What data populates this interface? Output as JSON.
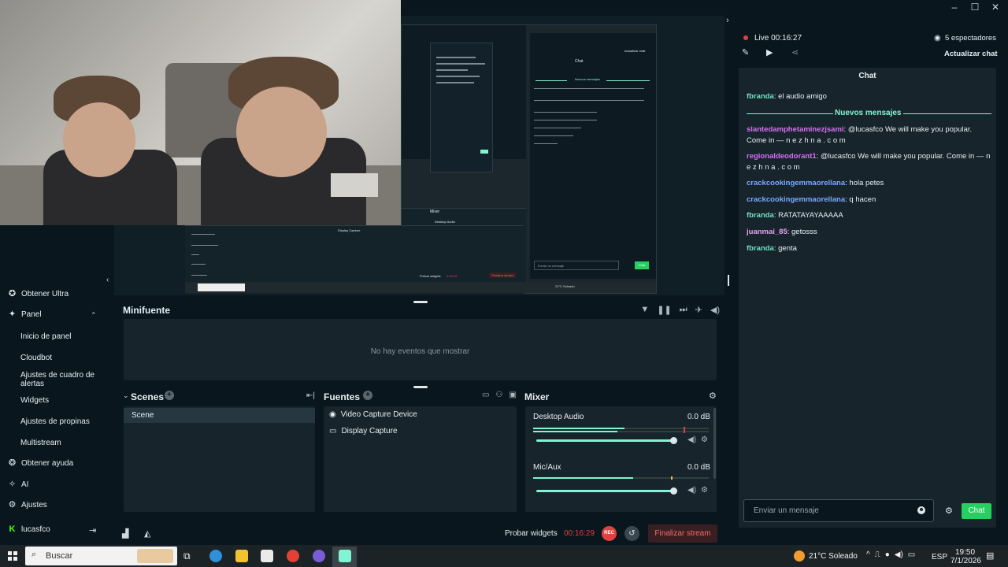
{
  "window": {
    "minimize": "–",
    "maximize": "☐",
    "close": "✕"
  },
  "preview": {
    "nested_chat_title": "Chat",
    "nested_new_messages": "Nuevos mensajes",
    "nested_update": "Actualizar chat",
    "nested_finalize": "Finalizar stream",
    "nested_probar": "Probar widgets",
    "nested_mixer": "Mixer",
    "nested_desktop_audio": "Desktop Audio",
    "nested_mic": "Mic/Aux",
    "nested_display": "Display Capture",
    "nested_input": "Enviar un mensaje",
    "nested_send": "Chat",
    "nested_time": "0:16:29",
    "nested_weather": "21°C Soleado"
  },
  "sidebar": {
    "items": [
      {
        "label": "Obtener Ultra",
        "icon": "ultra-icon"
      },
      {
        "label": "Panel",
        "icon": "dashboard-icon"
      },
      {
        "label": "Inicio de panel"
      },
      {
        "label": "Cloudbot"
      },
      {
        "label": "Ajustes de cuadro de alertas"
      },
      {
        "label": "Widgets"
      },
      {
        "label": "Ajustes de propinas"
      },
      {
        "label": "Multistream"
      },
      {
        "label": "Obtener ayuda",
        "icon": "help-icon"
      },
      {
        "label": "AI",
        "icon": "ai-icon"
      },
      {
        "label": "Ajustes",
        "icon": "gear-icon"
      },
      {
        "label": "lucasfco",
        "icon": "kick-icon"
      }
    ]
  },
  "minifuente": {
    "title": "Minifuente",
    "empty": "No hay eventos que mostrar"
  },
  "scenes": {
    "title": "Scenes",
    "items": [
      "Scene"
    ]
  },
  "sources": {
    "title": "Fuentes",
    "items": [
      "Video Capture Device",
      "Display Capture"
    ]
  },
  "mixer": {
    "title": "Mixer",
    "channels": [
      {
        "name": "Desktop Audio",
        "db": "0.0 dB",
        "level": 0.52,
        "volume": 1.0
      },
      {
        "name": "Mic/Aux",
        "db": "0.0 dB",
        "level": 0.57,
        "volume": 1.0
      }
    ]
  },
  "footer": {
    "probar": "Probar widgets",
    "time": "00:16:29",
    "rec": "REC",
    "end": "Finalizar stream"
  },
  "chat": {
    "live": "Live 00:16:27",
    "viewers": "5 espectadores",
    "update": "Actualizar chat",
    "title": "Chat",
    "new_messages": "Nuevos mensajes",
    "messages": [
      {
        "user": "fbranda",
        "text": ": el audio amigo",
        "color": "#6ee2c2"
      },
      {
        "user": "slantedamphetaminezjsami",
        "text": ": @lucasfco We will make you popular. Come in — n e z h n a . c o m",
        "color": "#d76ff3"
      },
      {
        "user": "regionaldeodorant1",
        "text": ": @lucasfco We will make you popular. Come in — n e z h n a . c o m",
        "color": "#d76ff3"
      },
      {
        "user": "crackcookingemmaorellana",
        "text": ": hola petes",
        "color": "#7aa9ff"
      },
      {
        "user": "crackcookingemmaorellana",
        "text": ": q hacen",
        "color": "#7aa9ff"
      },
      {
        "user": "fbranda",
        "text": ": RATATAYAYAAAAA",
        "color": "#6ee2c2"
      },
      {
        "user": "juanmai_85",
        "text": ": getosss",
        "color": "#e5a3f2"
      },
      {
        "user": "fbranda",
        "text": ": genta",
        "color": "#6ee2c2"
      }
    ],
    "input_placeholder": "Enviar un mensaje",
    "send": "Chat"
  },
  "taskbar": {
    "search": "Buscar",
    "weather": "21°C  Soleado",
    "lang": "ESP",
    "time": "19:50",
    "date": "7/1/2026"
  },
  "colors": {
    "accent": "#80f5d2",
    "live": "#e0403f",
    "send": "#24d05f"
  }
}
